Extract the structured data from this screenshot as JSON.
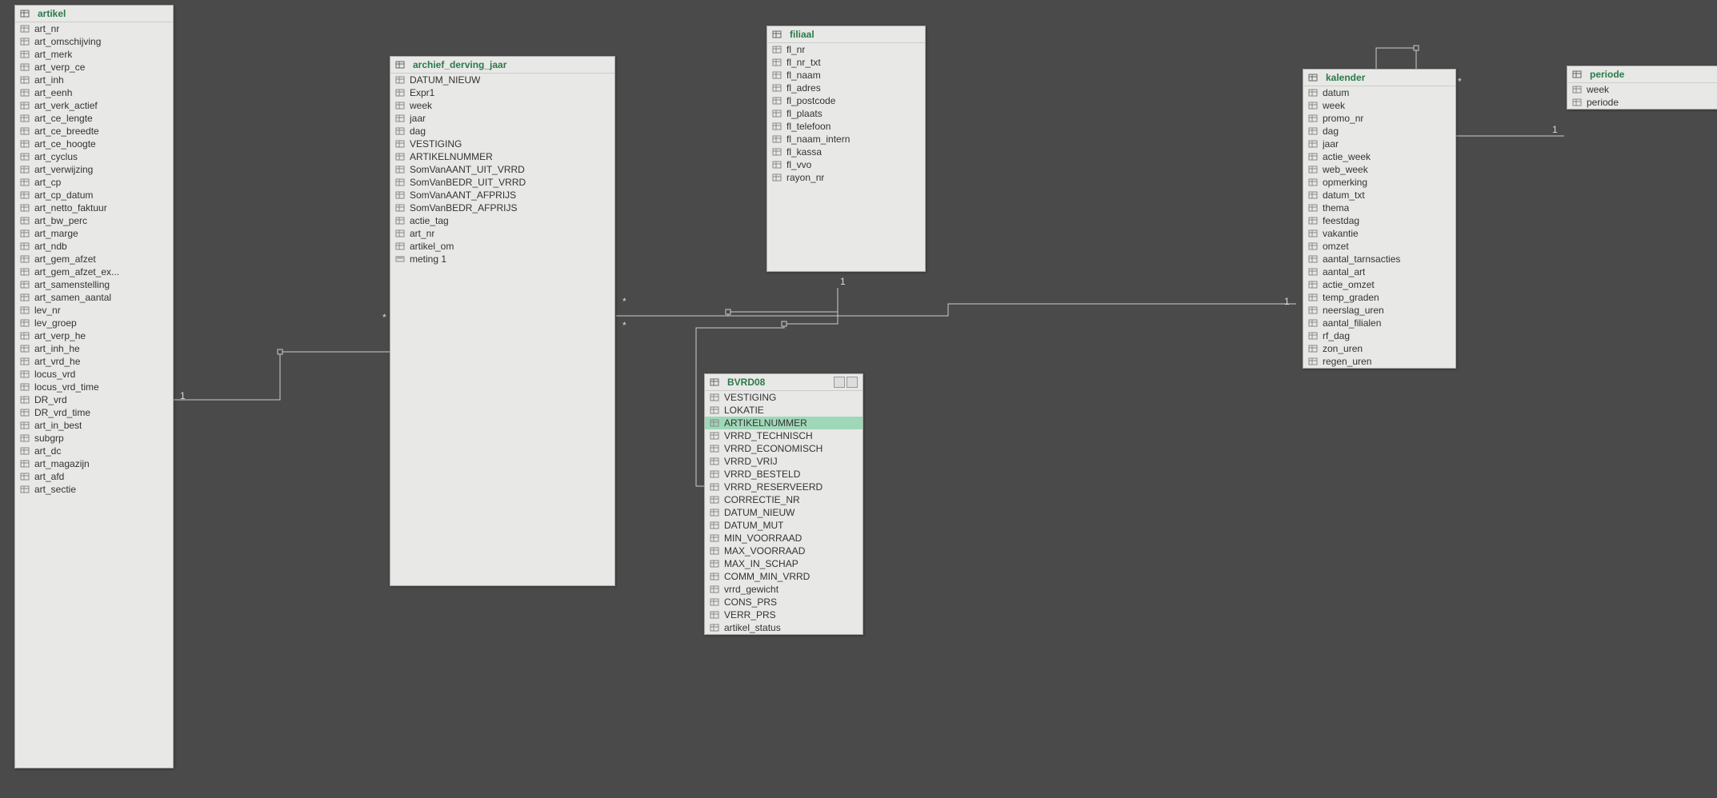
{
  "tables": {
    "artikel": {
      "title": "artikel",
      "fields": [
        "art_nr",
        "art_omschijving",
        "art_merk",
        "art_verp_ce",
        "art_inh",
        "art_eenh",
        "art_verk_actief",
        "art_ce_lengte",
        "art_ce_breedte",
        "art_ce_hoogte",
        "art_cyclus",
        "art_verwijzing",
        "art_cp",
        "art_cp_datum",
        "art_netto_faktuur",
        "art_bw_perc",
        "art_marge",
        "art_ndb",
        "art_gem_afzet",
        "art_gem_afzet_ex...",
        "art_samenstelling",
        "art_samen_aantal",
        "lev_nr",
        "lev_groep",
        "art_verp_he",
        "art_inh_he",
        "art_vrd_he",
        "locus_vrd",
        "locus_vrd_time",
        "DR_vrd",
        "DR_vrd_time",
        "art_in_best",
        "subgrp",
        "art_dc",
        "art_magazijn",
        "art_afd",
        "art_sectie"
      ]
    },
    "archief_derving_jaar": {
      "title": "archief_derving_jaar",
      "fields": [
        "DATUM_NIEUW",
        "Expr1",
        "week",
        "jaar",
        "dag",
        "VESTIGING",
        "ARTIKELNUMMER",
        "SomVanAANT_UIT_VRRD",
        "SomVanBEDR_UIT_VRRD",
        "SomVanAANT_AFPRIJS",
        "SomVanBEDR_AFPRIJS",
        "actie_tag",
        "art_nr",
        "artikel_om"
      ],
      "measure": "meting 1"
    },
    "filiaal": {
      "title": "filiaal",
      "fields": [
        "fl_nr",
        "fl_nr_txt",
        "fl_naam",
        "fl_adres",
        "fl_postcode",
        "fl_plaats",
        "fl_telefoon",
        "fl_naam_intern",
        "fl_kassa",
        "fl_vvo",
        "rayon_nr"
      ]
    },
    "bvrd08": {
      "title": "BVRD08",
      "fields": [
        {
          "name": "VESTIGING"
        },
        {
          "name": "LOKATIE"
        },
        {
          "name": "ARTIKELNUMMER",
          "selected": true
        },
        {
          "name": "VRRD_TECHNISCH"
        },
        {
          "name": "VRRD_ECONOMISCH"
        },
        {
          "name": "VRRD_VRIJ"
        },
        {
          "name": "VRRD_BESTELD"
        },
        {
          "name": "VRRD_RESERVEERD"
        },
        {
          "name": "CORRECTIE_NR"
        },
        {
          "name": "DATUM_NIEUW"
        },
        {
          "name": "DATUM_MUT"
        },
        {
          "name": "MIN_VOORRAAD"
        },
        {
          "name": "MAX_VOORRAAD"
        },
        {
          "name": "MAX_IN_SCHAP"
        },
        {
          "name": "COMM_MIN_VRRD"
        },
        {
          "name": "vrrd_gewicht"
        },
        {
          "name": "CONS_PRS"
        },
        {
          "name": "VERR_PRS"
        },
        {
          "name": "artikel_status"
        }
      ]
    },
    "kalender": {
      "title": "kalender",
      "fields": [
        "datum",
        "week",
        "promo_nr",
        "dag",
        "jaar",
        "actie_week",
        "web_week",
        "opmerking",
        "datum_txt",
        "thema",
        "feestdag",
        "vakantie",
        "omzet",
        "aantal_tarnsacties",
        "aantal_art",
        "actie_omzet",
        "temp_graden",
        "neerslag_uren",
        "aantal_filialen",
        "rf_dag",
        "zon_uren",
        "regen_uren"
      ]
    },
    "periode": {
      "title": "periode",
      "fields": [
        "week",
        "periode"
      ]
    }
  },
  "relation_labels": {
    "one": "1",
    "many": "*"
  }
}
